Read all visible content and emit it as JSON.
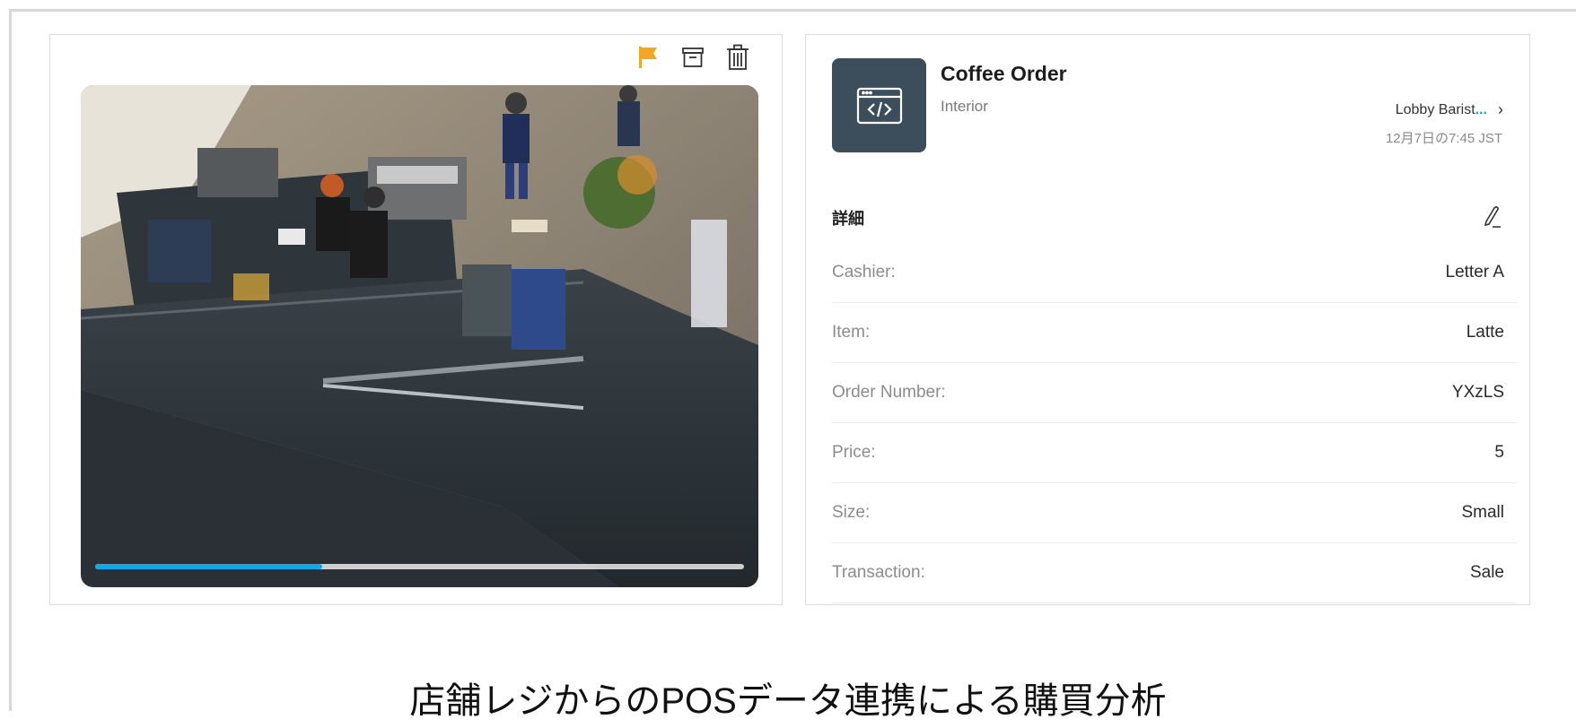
{
  "video_card": {
    "progress_fraction": 0.35
  },
  "toolbar_icons": [
    "flag-icon",
    "archive-icon",
    "trash-icon"
  ],
  "event": {
    "title": "Coffee Order",
    "subtitle": "Interior",
    "source_name": "Lobby Barist",
    "source_ellipsis": "...",
    "timestamp": "12月7日の7:45 JST"
  },
  "details": {
    "heading": "詳細",
    "rows": [
      {
        "label": "Cashier:",
        "value": "Letter A"
      },
      {
        "label": "Item:",
        "value": "Latte"
      },
      {
        "label": "Order Number:",
        "value": "YXzLS"
      },
      {
        "label": "Price:",
        "value": "5"
      },
      {
        "label": "Size:",
        "value": "Small"
      },
      {
        "label": "Transaction:",
        "value": "Sale"
      }
    ]
  },
  "caption": "店舗レジからのPOSデータ連携による購買分析",
  "colors": {
    "accent": "#11a7e8",
    "flag": "#f5a623",
    "tile": "#3c4e5b"
  }
}
